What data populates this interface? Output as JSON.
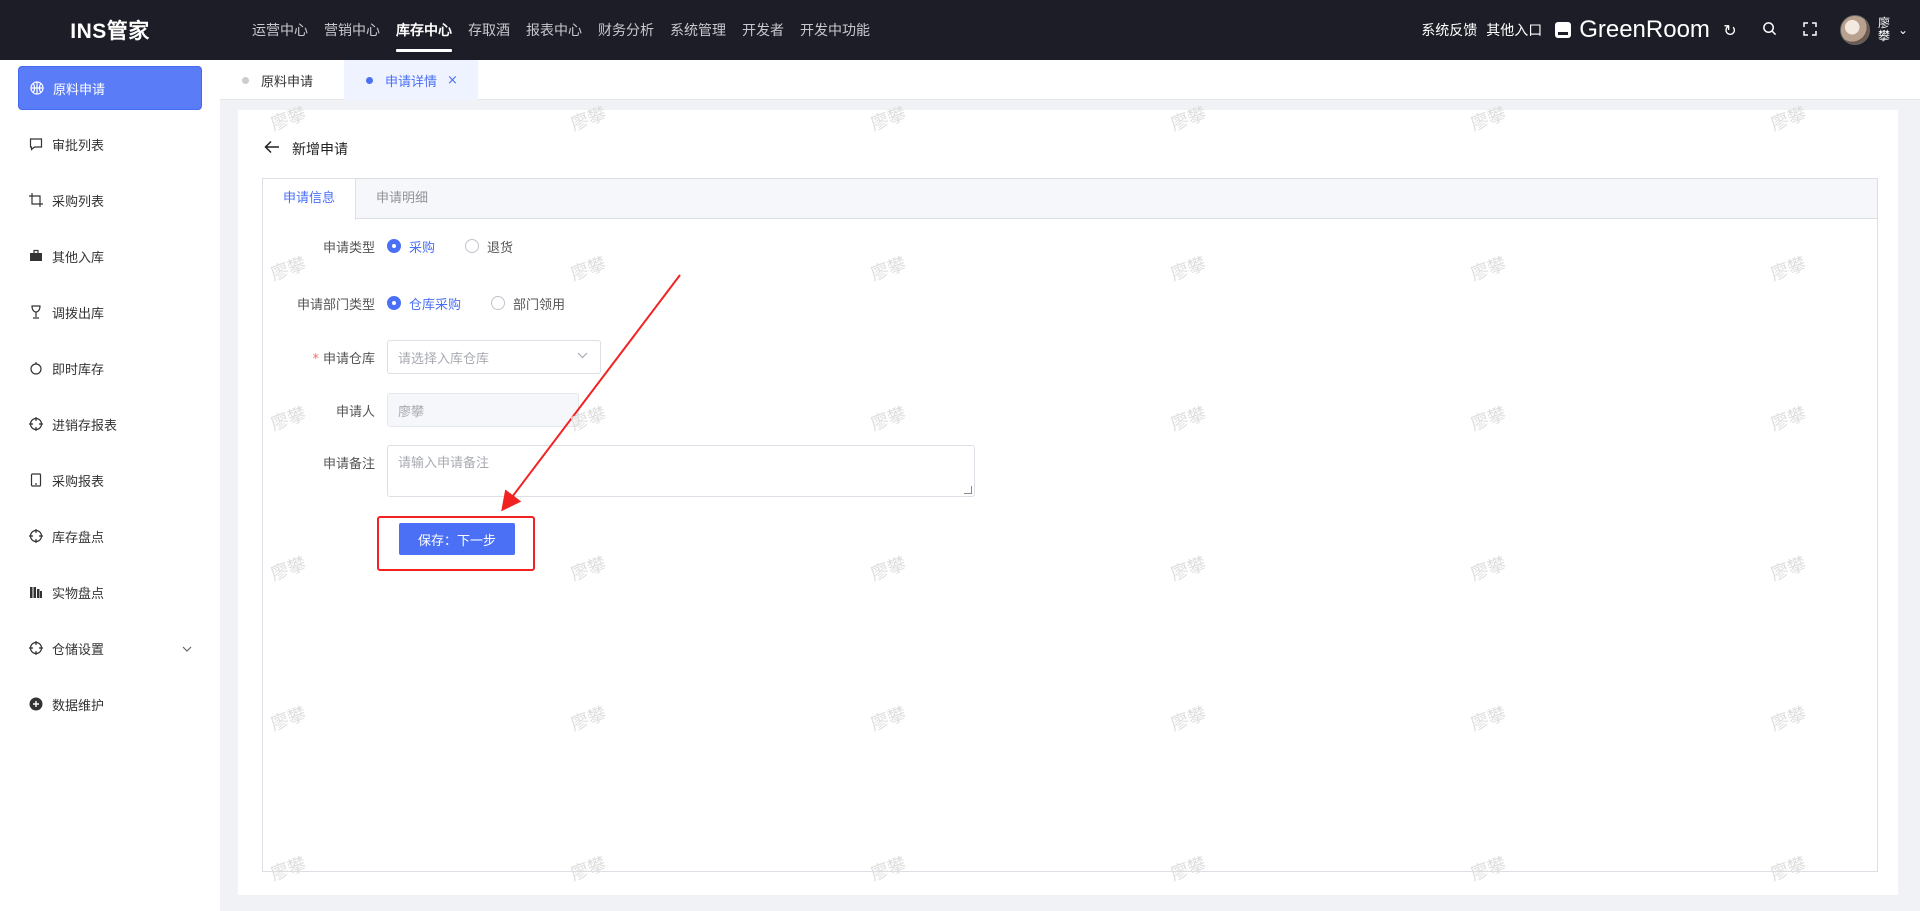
{
  "app": {
    "logo": "INS管家"
  },
  "topnav": {
    "items": [
      {
        "label": "运营中心",
        "active": false
      },
      {
        "label": "营销中心",
        "active": false
      },
      {
        "label": "库存中心",
        "active": true
      },
      {
        "label": "存取酒",
        "active": false
      },
      {
        "label": "报表中心",
        "active": false
      },
      {
        "label": "财务分析",
        "active": false
      },
      {
        "label": "系统管理",
        "active": false
      },
      {
        "label": "开发者",
        "active": false
      },
      {
        "label": "开发中功能",
        "active": false
      }
    ],
    "feedback": "系统反馈",
    "other_entry": "其他入口",
    "store_name": "GreenRoom",
    "user_name": "廖攀"
  },
  "sidebar": {
    "items": [
      {
        "label": "原料申请",
        "icon": "basketball-icon",
        "active": true
      },
      {
        "label": "审批列表",
        "icon": "chat-icon"
      },
      {
        "label": "采购列表",
        "icon": "crop-icon"
      },
      {
        "label": "其他入库",
        "icon": "suitcase-icon"
      },
      {
        "label": "调拨出库",
        "icon": "goblet-icon"
      },
      {
        "label": "即时库存",
        "icon": "apple-icon"
      },
      {
        "label": "进销存报表",
        "icon": "aim-icon"
      },
      {
        "label": "采购报表",
        "icon": "tablet-icon"
      },
      {
        "label": "库存盘点",
        "icon": "aim-icon"
      },
      {
        "label": "实物盘点",
        "icon": "books-icon"
      },
      {
        "label": "仓储设置",
        "icon": "aim-icon",
        "expandable": true
      },
      {
        "label": "数据维护",
        "icon": "plus-circle-icon"
      }
    ]
  },
  "page_tabs": [
    {
      "label": "原料申请",
      "active": false
    },
    {
      "label": "申请详情",
      "active": true,
      "close": "×"
    }
  ],
  "header": {
    "back_title": "新增申请"
  },
  "form_tabs": [
    {
      "label": "申请信息",
      "active": true
    },
    {
      "label": "申请明细",
      "active": false
    }
  ],
  "form": {
    "apply_type": {
      "label": "申请类型",
      "options": [
        "采购",
        "退货"
      ],
      "selected": "采购"
    },
    "dept_type": {
      "label": "申请部门类型",
      "options": [
        "仓库采购",
        "部门领用"
      ],
      "selected": "仓库采购"
    },
    "warehouse": {
      "label": "申请仓库",
      "required": true,
      "placeholder": "请选择入库仓库"
    },
    "applicant": {
      "label": "申请人",
      "value": "廖攀"
    },
    "remark": {
      "label": "申请备注",
      "placeholder": "请输入申请备注"
    },
    "submit_label": "保存：下一步"
  },
  "watermark": "廖攀",
  "colors": {
    "primary": "#4b70f5",
    "topbar": "#1c1d26",
    "annotation": "#f32222"
  }
}
